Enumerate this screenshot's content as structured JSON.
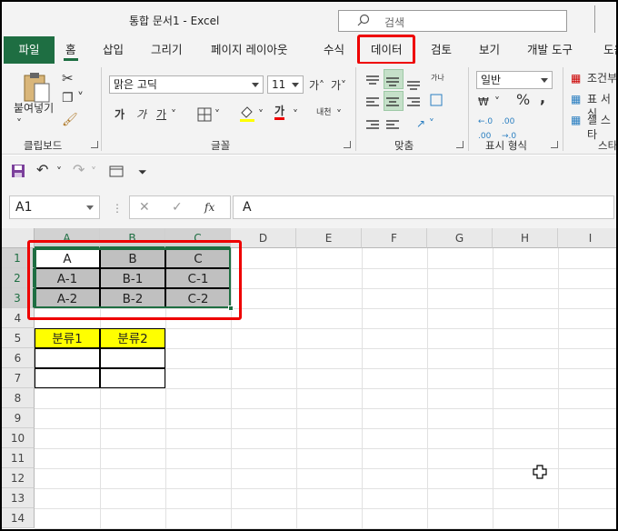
{
  "window": {
    "title": "통합 문서1  -  Excel",
    "search_placeholder": "검색"
  },
  "tabs": [
    "파일",
    "홈",
    "삽입",
    "그리기",
    "페이지 레이아웃",
    "수식",
    "데이터",
    "검토",
    "보기",
    "개발 도구",
    "도움"
  ],
  "ribbon": {
    "clipboard": {
      "paste_label": "붙여넣기",
      "group_label": "클립보드"
    },
    "font": {
      "font_name": "맑은 고딕",
      "font_size": "11",
      "bold": "가",
      "italic": "가",
      "underline": "가",
      "group_label": "글꼴",
      "grow": "가˄",
      "shrink": "가˅",
      "phonetic": "내천"
    },
    "alignment": {
      "group_label": "맞춤"
    },
    "number": {
      "format": "일반",
      "group_label": "표시 형식",
      "percent": "%",
      "comma": ",",
      "currency": "₩"
    },
    "styles": {
      "conditional": "조건부",
      "table": "표 서식",
      "cell": "셀 스타",
      "group_label": "스타"
    }
  },
  "formula_bar": {
    "name_box": "A1",
    "fx": "fx",
    "formula": "A"
  },
  "columns": [
    "A",
    "B",
    "C",
    "D",
    "E",
    "F",
    "G",
    "H",
    "I"
  ],
  "rows": [
    "1",
    "2",
    "3",
    "4",
    "5",
    "6",
    "7",
    "8",
    "9",
    "10",
    "11",
    "12",
    "13",
    "14"
  ],
  "cells": {
    "A1": "A",
    "B1": "B",
    "C1": "C",
    "A2": "A-1",
    "B2": "B-1",
    "C2": "C-1",
    "A3": "A-2",
    "B3": "B-2",
    "C3": "C-2",
    "A5": "분류1",
    "B5": "분류2"
  },
  "colors": {
    "accent": "#1e6e42",
    "highlight": "#ee0000",
    "header_fill": "#c0c0c0",
    "yellow": "#ffff00"
  }
}
